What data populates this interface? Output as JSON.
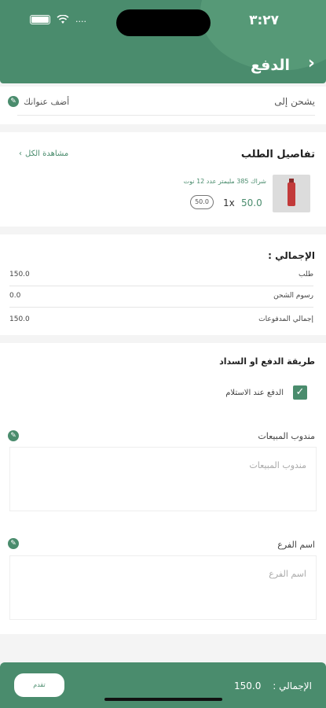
{
  "status": {
    "time": "٣:٢٧",
    "signal": "...."
  },
  "header": {
    "title": "الدفع"
  },
  "shipping": {
    "label": "يشحن إلى",
    "add_address": "أضف عنوانك"
  },
  "order": {
    "title": "تفاصيل الطلب",
    "view_all": "مشاهدة الكل",
    "item": {
      "name": "شراك 385 مليمتر عدد 12 نوت",
      "qty": "1x",
      "price": "50.0",
      "badge": "50.0"
    }
  },
  "totals": {
    "title": "الإجمالي :",
    "rows": [
      {
        "label": "طلب",
        "value": "150.0"
      },
      {
        "label": "رسوم الشحن",
        "value": "0.0"
      },
      {
        "label": "إجمالي المدفوعات",
        "value": "150.0"
      }
    ]
  },
  "payment": {
    "title": "طريقة الدفع او السداد",
    "option": "الدفع عند الاستلام",
    "option_checked": true,
    "sales_rep": {
      "label": "مندوب المبيعات",
      "placeholder": "مندوب المبيعات"
    },
    "branch": {
      "label": "اسم الفرع",
      "placeholder": "اسم الفرع"
    }
  },
  "footer": {
    "total_label": "الإجمالي :",
    "total_value": "150.0",
    "submit": "تقدم"
  },
  "colors": {
    "primary": "#4a8c6d",
    "background": "#f4f4f4"
  }
}
